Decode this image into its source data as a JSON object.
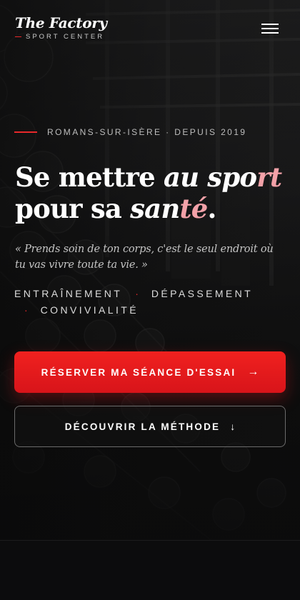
{
  "brand": {
    "title": "The Factory",
    "subtitle": "SPORT CENTER",
    "accent_color": "#e8282a"
  },
  "header": {
    "menu_icon": "hamburger-menu-icon"
  },
  "hero": {
    "eyebrow": "ROMANS-SUR-ISÈRE · DEPUIS 2019",
    "headline": {
      "part1": "Se mettre ",
      "part2_em": "au spo",
      "part2_em_pink": "rt",
      "line2_a": "pour sa ",
      "line2_em": "san",
      "line2_em_pink": "té",
      "line2_end": "."
    },
    "quote": "« Prends soin de ton corps, c'est le seul endroit où tu vas vivre toute ta vie. »",
    "values": [
      "ENTRAÎNEMENT",
      "DÉPASSEMENT",
      "CONVIVIALITÉ"
    ],
    "value_separator": "·",
    "cta_primary": {
      "label": "RÉSERVER MA SÉANCE D'ESSAI",
      "icon": "→"
    },
    "cta_secondary": {
      "label": "DÉCOUVRIR LA MÉTHODE",
      "icon": "↓"
    }
  },
  "colors": {
    "primary_button": "#e8191d",
    "headline_pink": "#f2a1a8"
  }
}
